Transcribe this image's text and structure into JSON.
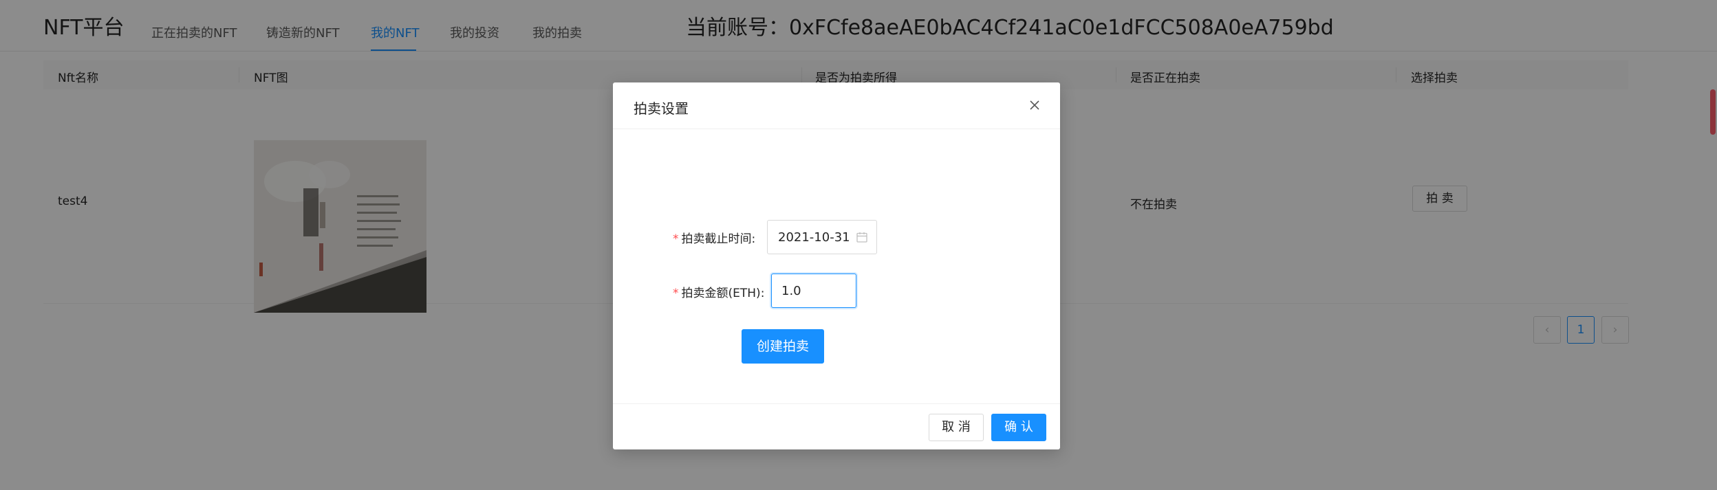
{
  "header": {
    "brand": "NFT平台",
    "nav": [
      {
        "label": "正在拍卖的NFT"
      },
      {
        "label": "铸造新的NFT"
      },
      {
        "label": "我的NFT"
      },
      {
        "label": "我的投资"
      },
      {
        "label": "我的拍卖"
      }
    ],
    "active_nav": "我的NFT",
    "account": "当前账号：0xFCfe8aeAE0bAC4Cf241aC0e1dFCC508A0eA759bd"
  },
  "table": {
    "columns": [
      "Nft名称",
      "NFT图",
      "是否为拍卖所得",
      "是否正在拍卖",
      "选择拍卖"
    ],
    "rows": [
      {
        "name": "test4",
        "image": "gallery-wall-photo",
        "auction_status": "不在拍卖",
        "action_label": "拍 卖"
      }
    ]
  },
  "pagination": {
    "prev": "‹",
    "current": "1",
    "next": "›"
  },
  "modal": {
    "title": "拍卖设置",
    "close_icon": "close-icon",
    "deadline_label": "拍卖截止时间",
    "deadline_value": "2021-10-31",
    "amount_label": "拍卖金额(ETH)",
    "amount_value": "1.0",
    "create_label": "创建拍卖",
    "cancel_label": "取 消",
    "ok_label": "确 认"
  },
  "colors": {
    "primary": "#1890ff",
    "required": "#ff4d4f",
    "scroll_thumb": "#ff5f6d"
  }
}
